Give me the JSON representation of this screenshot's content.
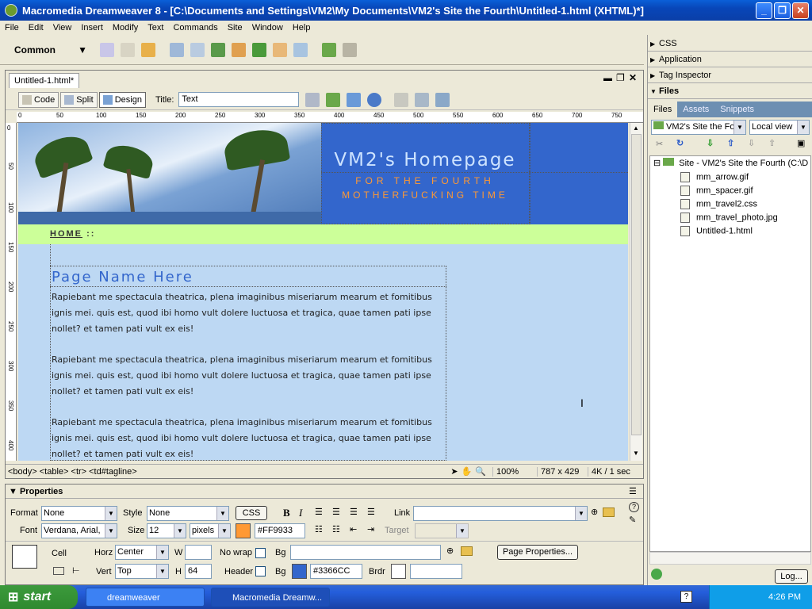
{
  "window": {
    "title": "Macromedia Dreamweaver 8 - [C:\\Documents and Settings\\VM2\\My Documents\\VM2's Site the Fourth\\Untitled-1.html (XHTML)*]"
  },
  "menu": [
    "File",
    "Edit",
    "View",
    "Insert",
    "Modify",
    "Text",
    "Commands",
    "Site",
    "Window",
    "Help"
  ],
  "insert_bar": {
    "category": "Common"
  },
  "document": {
    "tab": "Untitled-1.html*",
    "views": {
      "code": "Code",
      "split": "Split",
      "design": "Design"
    },
    "title_label": "Title:",
    "title_value": "Text",
    "ruler_h": [
      "0",
      "50",
      "100",
      "150",
      "200",
      "250",
      "300",
      "350",
      "400",
      "450",
      "500",
      "550",
      "600",
      "650",
      "700",
      "750"
    ],
    "ruler_v": [
      "0",
      "50",
      "100",
      "150",
      "200",
      "250",
      "300",
      "350",
      "400"
    ]
  },
  "page": {
    "site_title": "VM2's Homepage",
    "subtitle_1": "FOR THE FOURTH",
    "subtitle_2": "MOTHERFUCKING TIME",
    "nav_home": "HOME",
    "nav_sep": "::",
    "page_name": "Page Name Here",
    "paragraphs": [
      "Rapiebant me spectacula theatrica, plena imaginibus miseriarum mearum et fomitibus ignis mei. quis est, quod ibi homo vult dolere luctuosa et tragica, quae tamen pati ipse nollet? et tamen pati vult ex eis!",
      "Rapiebant me spectacula theatrica, plena imaginibus miseriarum mearum et fomitibus ignis mei. quis est, quod ibi homo vult dolere luctuosa et tragica, quae tamen pati ipse nollet? et tamen pati vult ex eis!",
      "Rapiebant me spectacula theatrica, plena imaginibus miseriarum mearum et fomitibus ignis mei. quis est, quod ibi homo vult dolere luctuosa et tragica, quae tamen pati ipse nollet? et tamen pati vult ex eis!"
    ]
  },
  "status": {
    "tags": "<body> <table> <tr> <td#tagline>",
    "zoom": "100%",
    "size": "787 x 429",
    "download": "4K / 1 sec"
  },
  "properties": {
    "title": "Properties",
    "format_label": "Format",
    "format_value": "None",
    "style_label": "Style",
    "style_value": "None",
    "css_button": "CSS",
    "link_label": "Link",
    "font_label": "Font",
    "font_value": "Verdana, Arial,",
    "size_label": "Size",
    "size_value": "12",
    "unit_value": "pixels",
    "text_color": "#FF9933",
    "target_label": "Target",
    "cell_label": "Cell",
    "horz_label": "Horz",
    "horz_value": "Center",
    "w_label": "W",
    "nowrap_label": "No wrap",
    "bg_label": "Bg",
    "page_properties_button": "Page Properties...",
    "vert_label": "Vert",
    "vert_value": "Top",
    "h_label": "H",
    "h_value": "64",
    "header_label": "Header",
    "bg2_label": "Bg",
    "bg_color": "#3366CC",
    "brdr_label": "Brdr"
  },
  "panels": {
    "css": "CSS",
    "application": "Application",
    "tag_inspector": "Tag Inspector",
    "files": "Files",
    "tabs": [
      "Files",
      "Assets",
      "Snippets"
    ],
    "site_select": "VM2's Site the Fo",
    "view_select": "Local view",
    "root": "Site - VM2's Site the Fourth (C:\\D",
    "files_list": [
      "mm_arrow.gif",
      "mm_spacer.gif",
      "mm_travel2.css",
      "mm_travel_photo.jpg",
      "Untitled-1.html"
    ],
    "log_button": "Log..."
  },
  "taskbar": {
    "start": "start",
    "tasks": [
      "dreamweaver",
      "Macromedia Dreamw..."
    ],
    "clock": "4:26 PM"
  },
  "colors": {
    "accent": "#3366cc",
    "nav": "#ccff99",
    "body": "#bdd8f3",
    "orange": "#ff9933"
  }
}
